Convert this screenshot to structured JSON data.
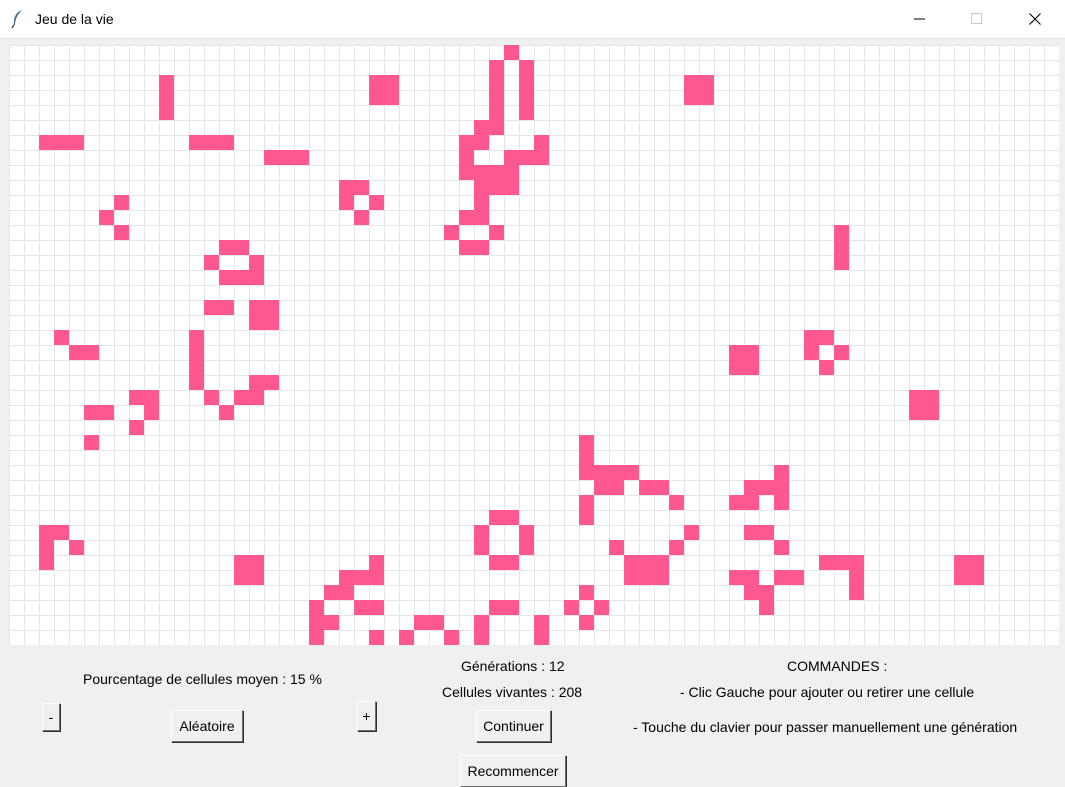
{
  "window": {
    "title": "Jeu de la vie",
    "icon": "feather-icon",
    "controls": [
      "minimize-icon",
      "maximize-icon",
      "close-icon"
    ]
  },
  "grid": {
    "cell_color": "#ff5790",
    "line_color": "#e6e6e6",
    "background": "#ffffff",
    "live_cells": [
      [
        0,
        33
      ],
      [
        1,
        32
      ],
      [
        1,
        34
      ],
      [
        2,
        10
      ],
      [
        2,
        24
      ],
      [
        2,
        25
      ],
      [
        2,
        32
      ],
      [
        2,
        34
      ],
      [
        2,
        45
      ],
      [
        2,
        46
      ],
      [
        3,
        10
      ],
      [
        3,
        24
      ],
      [
        3,
        25
      ],
      [
        3,
        32
      ],
      [
        3,
        34
      ],
      [
        3,
        45
      ],
      [
        3,
        46
      ],
      [
        4,
        10
      ],
      [
        4,
        32
      ],
      [
        4,
        34
      ],
      [
        5,
        31
      ],
      [
        5,
        32
      ],
      [
        6,
        2
      ],
      [
        6,
        3
      ],
      [
        6,
        4
      ],
      [
        6,
        12
      ],
      [
        6,
        13
      ],
      [
        6,
        14
      ],
      [
        6,
        30
      ],
      [
        6,
        31
      ],
      [
        6,
        35
      ],
      [
        7,
        17
      ],
      [
        7,
        18
      ],
      [
        7,
        19
      ],
      [
        7,
        30
      ],
      [
        7,
        33
      ],
      [
        7,
        34
      ],
      [
        7,
        35
      ],
      [
        8,
        30
      ],
      [
        8,
        31
      ],
      [
        8,
        32
      ],
      [
        8,
        33
      ],
      [
        9,
        22
      ],
      [
        9,
        23
      ],
      [
        9,
        31
      ],
      [
        9,
        32
      ],
      [
        9,
        33
      ],
      [
        10,
        7
      ],
      [
        10,
        22
      ],
      [
        10,
        24
      ],
      [
        10,
        31
      ],
      [
        11,
        6
      ],
      [
        11,
        23
      ],
      [
        11,
        30
      ],
      [
        11,
        31
      ],
      [
        12,
        7
      ],
      [
        12,
        29
      ],
      [
        12,
        32
      ],
      [
        12,
        55
      ],
      [
        13,
        14
      ],
      [
        13,
        15
      ],
      [
        13,
        30
      ],
      [
        13,
        31
      ],
      [
        13,
        55
      ],
      [
        14,
        13
      ],
      [
        14,
        16
      ],
      [
        14,
        55
      ],
      [
        15,
        14
      ],
      [
        15,
        15
      ],
      [
        15,
        16
      ],
      [
        17,
        13
      ],
      [
        17,
        14
      ],
      [
        17,
        16
      ],
      [
        17,
        17
      ],
      [
        18,
        16
      ],
      [
        18,
        17
      ],
      [
        19,
        3
      ],
      [
        19,
        12
      ],
      [
        19,
        53
      ],
      [
        19,
        54
      ],
      [
        20,
        4
      ],
      [
        20,
        5
      ],
      [
        20,
        12
      ],
      [
        20,
        48
      ],
      [
        20,
        49
      ],
      [
        20,
        53
      ],
      [
        20,
        55
      ],
      [
        21,
        12
      ],
      [
        21,
        48
      ],
      [
        21,
        49
      ],
      [
        21,
        54
      ],
      [
        22,
        12
      ],
      [
        22,
        16
      ],
      [
        22,
        17
      ],
      [
        23,
        8
      ],
      [
        23,
        9
      ],
      [
        23,
        13
      ],
      [
        23,
        15
      ],
      [
        23,
        16
      ],
      [
        23,
        60
      ],
      [
        23,
        61
      ],
      [
        24,
        5
      ],
      [
        24,
        6
      ],
      [
        24,
        9
      ],
      [
        24,
        14
      ],
      [
        24,
        60
      ],
      [
        24,
        61
      ],
      [
        25,
        8
      ],
      [
        26,
        5
      ],
      [
        26,
        38
      ],
      [
        27,
        38
      ],
      [
        28,
        38
      ],
      [
        28,
        39
      ],
      [
        28,
        40
      ],
      [
        28,
        41
      ],
      [
        28,
        51
      ],
      [
        29,
        39
      ],
      [
        29,
        40
      ],
      [
        29,
        42
      ],
      [
        29,
        43
      ],
      [
        29,
        49
      ],
      [
        29,
        50
      ],
      [
        29,
        51
      ],
      [
        30,
        38
      ],
      [
        30,
        44
      ],
      [
        30,
        48
      ],
      [
        30,
        49
      ],
      [
        30,
        51
      ],
      [
        31,
        38
      ],
      [
        31,
        32
      ],
      [
        31,
        33
      ],
      [
        32,
        2
      ],
      [
        32,
        3
      ],
      [
        32,
        31
      ],
      [
        32,
        34
      ],
      [
        32,
        45
      ],
      [
        32,
        49
      ],
      [
        32,
        50
      ],
      [
        33,
        2
      ],
      [
        33,
        4
      ],
      [
        33,
        31
      ],
      [
        33,
        34
      ],
      [
        33,
        40
      ],
      [
        33,
        44
      ],
      [
        33,
        51
      ],
      [
        34,
        2
      ],
      [
        34,
        15
      ],
      [
        34,
        16
      ],
      [
        34,
        24
      ],
      [
        34,
        32
      ],
      [
        34,
        33
      ],
      [
        34,
        41
      ],
      [
        34,
        42
      ],
      [
        34,
        43
      ],
      [
        34,
        54
      ],
      [
        34,
        55
      ],
      [
        34,
        56
      ],
      [
        34,
        63
      ],
      [
        34,
        64
      ],
      [
        35,
        15
      ],
      [
        35,
        16
      ],
      [
        35,
        22
      ],
      [
        35,
        23
      ],
      [
        35,
        24
      ],
      [
        35,
        41
      ],
      [
        35,
        42
      ],
      [
        35,
        43
      ],
      [
        35,
        48
      ],
      [
        35,
        49
      ],
      [
        35,
        51
      ],
      [
        35,
        52
      ],
      [
        35,
        56
      ],
      [
        35,
        63
      ],
      [
        35,
        64
      ],
      [
        36,
        21
      ],
      [
        36,
        22
      ],
      [
        36,
        38
      ],
      [
        36,
        49
      ],
      [
        36,
        50
      ],
      [
        36,
        56
      ],
      [
        37,
        20
      ],
      [
        37,
        23
      ],
      [
        37,
        24
      ],
      [
        37,
        32
      ],
      [
        37,
        33
      ],
      [
        37,
        37
      ],
      [
        37,
        39
      ],
      [
        37,
        50
      ],
      [
        38,
        20
      ],
      [
        38,
        21
      ],
      [
        38,
        27
      ],
      [
        38,
        28
      ],
      [
        38,
        31
      ],
      [
        38,
        35
      ],
      [
        38,
        38
      ],
      [
        39,
        20
      ],
      [
        39,
        24
      ],
      [
        39,
        26
      ],
      [
        39,
        29
      ],
      [
        39,
        31
      ],
      [
        39,
        35
      ],
      [
        40,
        24
      ],
      [
        40,
        27
      ],
      [
        40,
        28
      ],
      [
        40,
        31
      ],
      [
        40,
        35
      ],
      [
        41,
        18
      ],
      [
        41,
        31
      ],
      [
        41,
        32
      ],
      [
        41,
        33
      ],
      [
        41,
        34
      ],
      [
        41,
        35
      ],
      [
        41,
        22
      ],
      [
        41,
        17
      ]
    ]
  },
  "controls": {
    "percentage_label": "Pourcentage de cellules moyen : 15 %",
    "minus_label": "-",
    "plus_label": "+",
    "random_label": "Aléatoire",
    "generations_label": "Générations : 12",
    "live_cells_label": "Cellules vivantes : 208",
    "continue_label": "Continuer",
    "restart_label": "Recommencer"
  },
  "commands": {
    "heading": "COMMANDES :",
    "line1": "- Clic Gauche pour ajouter ou retirer une cellule",
    "line2": "- Touche du clavier pour passer manuellement une génération"
  }
}
